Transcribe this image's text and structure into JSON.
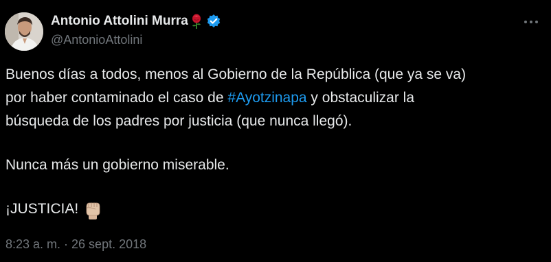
{
  "author": {
    "display_name": "Antonio Attolini Murra",
    "handle": "@AntonioAttolini",
    "emoji_icon": "rose-icon",
    "verified_icon": "verified-badge-icon"
  },
  "tweet": {
    "line1": "Buenos días a todos, menos al Gobierno de la República (que ya se va)",
    "line2_before": "por haber contaminado el caso de ",
    "hashtag": "#Ayotzinapa",
    "line2_after": " y obstaculizar la",
    "line3": "búsqueda de los padres por justicia (que nunca llegó).",
    "line4": "Nunca más un gobierno miserable.",
    "line5": "¡JUSTICIA!",
    "line5_emoji_icon": "raised-fist-icon"
  },
  "timestamp": "8:23 a. m. · 26 sept. 2018",
  "colors": {
    "background": "#000000",
    "text": "#e7e9ea",
    "muted": "#71767b",
    "link": "#1d9bf0",
    "verified": "#1d9bf0"
  }
}
